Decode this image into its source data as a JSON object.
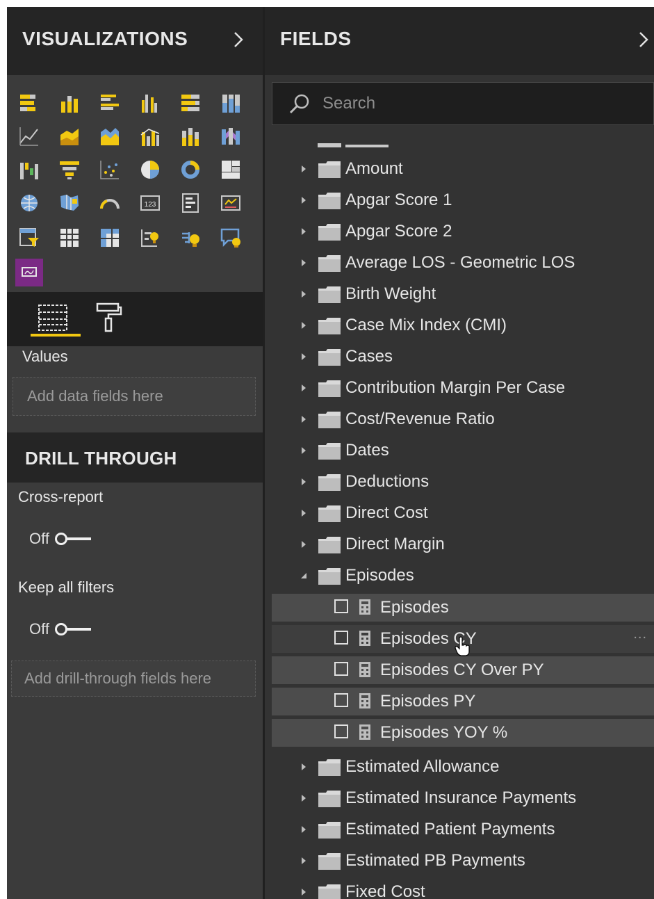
{
  "visualizations": {
    "title": "VISUALIZATIONS",
    "expand_icon": "chevron-right-icon",
    "icons": [
      "stacked-bar-icon",
      "stacked-column-icon",
      "clustered-bar-icon",
      "clustered-column-icon",
      "100-stacked-bar-icon",
      "100-stacked-column-icon",
      "line-chart-icon",
      "area-chart-icon",
      "stacked-area-icon",
      "line-clustered-column-icon",
      "line-stacked-column-icon",
      "ribbon-chart-icon",
      "waterfall-icon",
      "funnel-icon",
      "scatter-icon",
      "pie-icon",
      "donut-icon",
      "treemap-icon",
      "map-icon",
      "filled-map-icon",
      "gauge-icon",
      "card-icon",
      "multi-row-card-icon",
      "kpi-icon",
      "slicer-icon",
      "table-icon",
      "matrix-icon",
      "r-script-icon",
      "key-influencers-icon",
      "qa-icon",
      "custom-visual-icon"
    ],
    "tabs": {
      "fields_tab_icon": "fields-tab-icon",
      "format_tab_icon": "paint-roller-icon"
    },
    "values_label": "Values",
    "values_placeholder": "Add data fields here"
  },
  "drill_through": {
    "title": "DRILL THROUGH",
    "cross_report_label": "Cross-report",
    "cross_report_state": "Off",
    "keep_filters_label": "Keep all filters",
    "keep_filters_state": "Off",
    "placeholder": "Add drill-through fields here"
  },
  "fields": {
    "title": "FIELDS",
    "expand_icon": "chevron-right-icon",
    "search_placeholder": "Search",
    "tables": [
      {
        "name": "Amount",
        "expanded": false
      },
      {
        "name": "Apgar Score 1",
        "expanded": false
      },
      {
        "name": "Apgar Score 2",
        "expanded": false
      },
      {
        "name": "Average LOS - Geometric LOS",
        "expanded": false
      },
      {
        "name": "Birth Weight",
        "expanded": false
      },
      {
        "name": "Case Mix Index (CMI)",
        "expanded": false
      },
      {
        "name": "Cases",
        "expanded": false
      },
      {
        "name": "Contribution Margin Per Case",
        "expanded": false
      },
      {
        "name": "Cost/Revenue Ratio",
        "expanded": false
      },
      {
        "name": "Dates",
        "expanded": false
      },
      {
        "name": "Deductions",
        "expanded": false
      },
      {
        "name": "Direct Cost",
        "expanded": false
      },
      {
        "name": "Direct Margin",
        "expanded": false
      },
      {
        "name": "Episodes",
        "expanded": true
      }
    ],
    "measures": [
      {
        "name": "Episodes",
        "checked": false
      },
      {
        "name": "Episodes CY",
        "checked": false
      },
      {
        "name": "Episodes CY Over PY",
        "checked": false
      },
      {
        "name": "Episodes PY",
        "checked": false
      },
      {
        "name": "Episodes YOY %",
        "checked": false
      }
    ],
    "more_options": "...",
    "tables_after": [
      {
        "name": "Estimated Allowance",
        "expanded": false
      },
      {
        "name": "Estimated Insurance Payments",
        "expanded": false
      },
      {
        "name": "Estimated Patient Payments",
        "expanded": false
      },
      {
        "name": "Estimated PB Payments",
        "expanded": false
      },
      {
        "name": "Fixed Cost",
        "expanded": false
      }
    ]
  },
  "colors": {
    "accent": "#f2c811",
    "panel_bg": "#3b3b3b",
    "header_bg": "#252525",
    "custom_visual_bg": "#7b2a85"
  }
}
